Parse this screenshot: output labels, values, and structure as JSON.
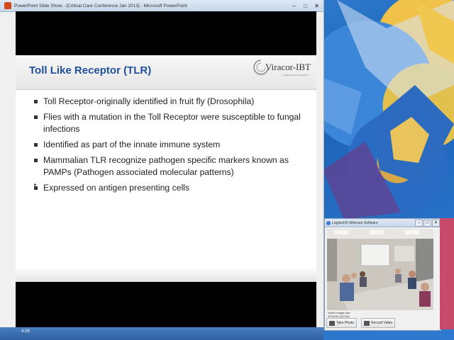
{
  "ppt_window": {
    "title": "PowerPoint Slide Show - [Critical Care Conference Jan 2013] - Microsoft PowerPoint",
    "minimize": "–",
    "maximize": "□",
    "close": "✕"
  },
  "slide": {
    "title": "Toll Like Receptor (TLR)",
    "logo": "Viracor-IBT",
    "logo_sub": "LABORATORIES",
    "bullets": [
      "Toll Receptor-originally identified in fruit fly (Drosophila)",
      "Flies with a mutation in the Toll Receptor were susceptible to fungal infections",
      "Identified as part of the innate immune system",
      "Mammalian TLR recognize pathogen specific markers known as PAMPs (Pathogen associated molecular patterns)",
      "Expressed on antigen presenting cells"
    ]
  },
  "taskbar": {
    "clock": "4:26"
  },
  "webcam_window": {
    "title": "Logitech® Webcam Software",
    "status_line1": "Select Image size",
    "status_line2": "320x240 (QVGA)",
    "take_photo": "Take Photo",
    "record_video": "Record Video"
  },
  "icons": {
    "ppt_app": "powerpoint-icon",
    "cam_app": "webcam-icon",
    "photo": "camera-icon",
    "video": "film-icon"
  }
}
